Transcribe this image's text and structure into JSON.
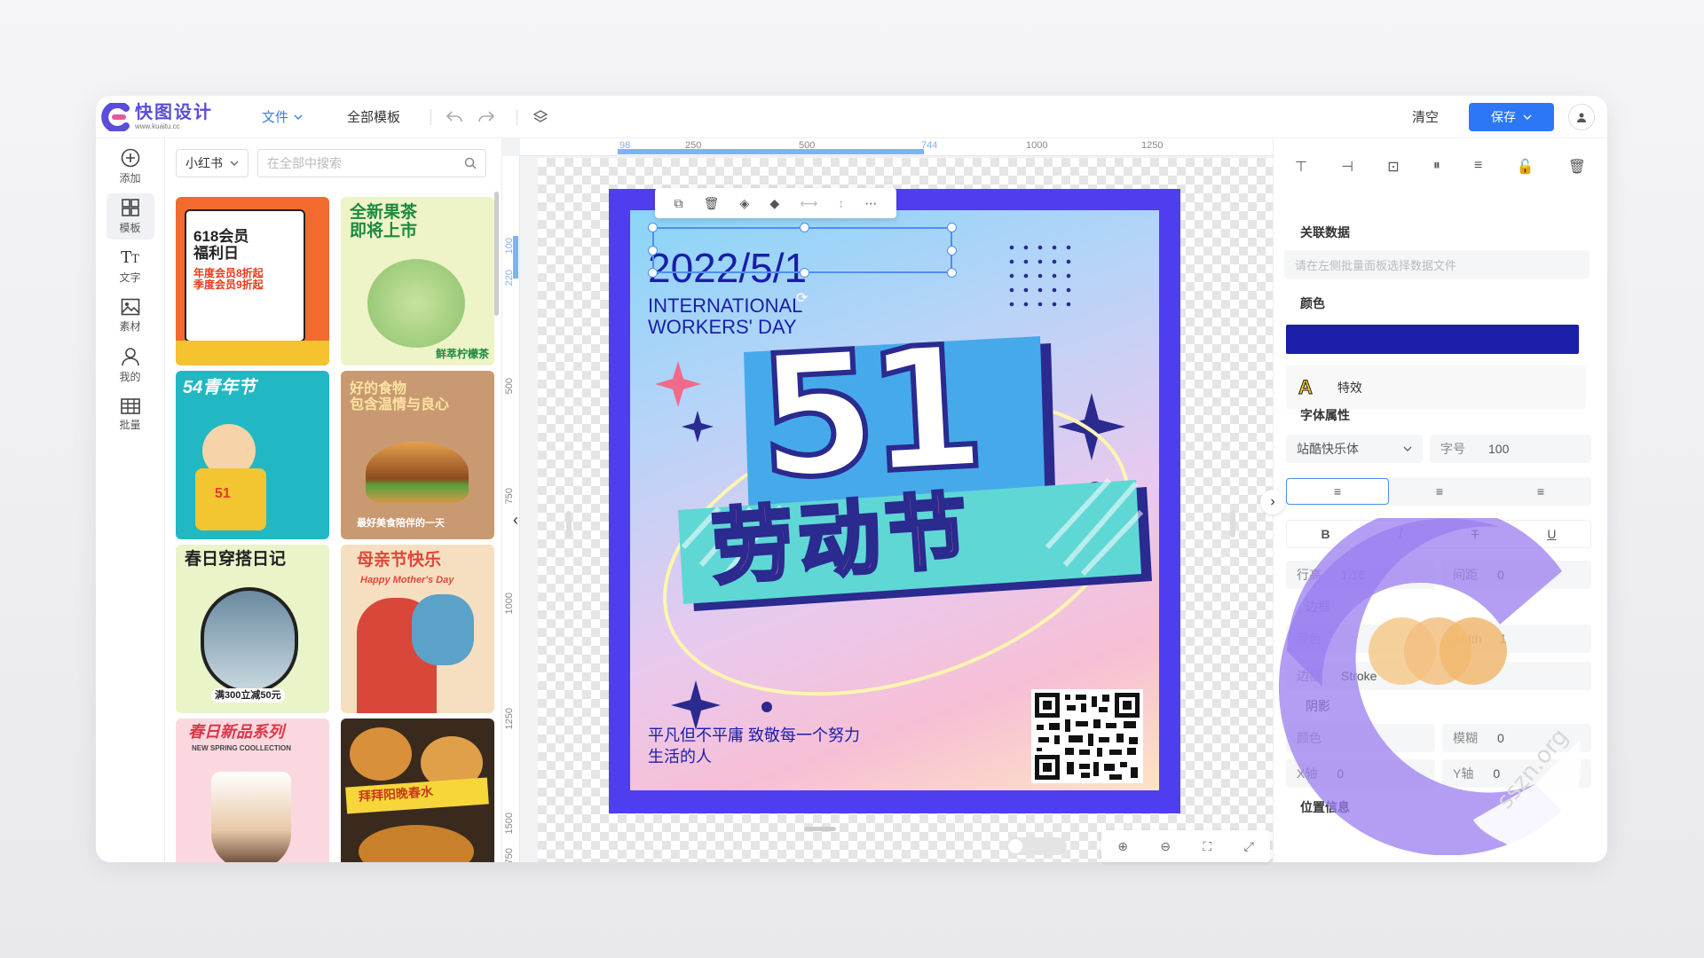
{
  "app": {
    "logo_name": "快图设计",
    "logo_url": "www.kuaitu.cc",
    "colors": {
      "brand": "#5b4cd9",
      "accent": "#2b77f5",
      "poster_frame": "#4e3ef0",
      "text_color": "#1a1ea8"
    }
  },
  "topbar": {
    "file_menu": "文件",
    "all_templates": "全部模板",
    "undo_icon": "undo-icon",
    "redo_icon": "redo-icon",
    "layers_icon": "layers-icon",
    "clear_label": "清空",
    "save_label": "保存"
  },
  "sidebar": {
    "items": [
      {
        "label": "添加",
        "icon": "plus-circle-icon"
      },
      {
        "label": "模板",
        "icon": "template-icon"
      },
      {
        "label": "文字",
        "icon": "text-icon"
      },
      {
        "label": "素材",
        "icon": "image-icon"
      },
      {
        "label": "我的",
        "icon": "user-icon"
      },
      {
        "label": "批量",
        "icon": "table-icon"
      }
    ]
  },
  "panel": {
    "category": "小红书",
    "search_placeholder": "在全部中搜索",
    "templates": [
      {
        "title": "618会员\n福利日",
        "sub": "年度会员8折起\n季度会员9折起"
      },
      {
        "title": "全新果茶\n即将上市",
        "sub": "鲜萃柠檬茶"
      },
      {
        "title": "54青年节",
        "sub": "51"
      },
      {
        "title": "好的食物\n包含温情与良心",
        "sub": "最好美食陪伴的一天"
      },
      {
        "title": "春日穿搭日记",
        "sub": "满300立减50元"
      },
      {
        "title": "母亲节快乐",
        "sub": "Happy Mother's Day"
      },
      {
        "title": "春日新品系列",
        "sub": "NEW SPRING COOLLECTION"
      },
      {
        "title": "拜拜阳晚春水",
        "sub": ""
      }
    ]
  },
  "rulers": {
    "h_ticks": [
      "98",
      "250",
      "500",
      "744",
      "1000",
      "1250"
    ],
    "v_ticks": [
      "100",
      "220",
      "500",
      "750",
      "1000",
      "1250",
      "1500",
      "1750"
    ]
  },
  "poster": {
    "date": "2022/5/1",
    "subtitle_line1": "INTERNATIONAL",
    "subtitle_line2": "WORKERS' DAY",
    "big_number": "51",
    "headline": "劳动节",
    "slogan_line1": "平凡但不平庸 致敬每一个努力",
    "slogan_line2": "生活的人"
  },
  "right_panel": {
    "linked_data_label": "关联数据",
    "linked_data_placeholder": "请在左侧批量面板选择数据文件",
    "color_label": "颜色",
    "fx_label": "特效",
    "font_attr_label": "字体属性",
    "font_family": "站酷快乐体",
    "font_size_label": "字号",
    "font_size": "100",
    "bold": "B",
    "italic": "I",
    "strike": "T",
    "underline": "U",
    "line_height_label": "行高",
    "line_height": "1.16",
    "spacing_label": "间距",
    "spacing": "0",
    "border_label": "边框",
    "border_color_label": "颜色",
    "border_width_label": "width",
    "border_width": "1",
    "border_style_label": "边框",
    "border_style": "Stroke",
    "shadow_label": "阴影",
    "shadow_color_label": "颜色",
    "blur_label": "模糊",
    "blur": "0",
    "x_label": "X轴",
    "x": "0",
    "y_label": "Y轴",
    "y": "0",
    "position_label": "位置信息"
  },
  "watermark": "sszn.org"
}
